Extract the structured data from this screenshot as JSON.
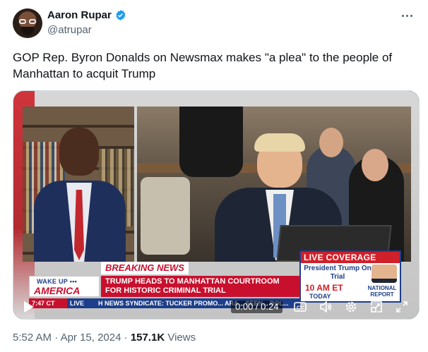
{
  "author": {
    "name": "Aaron Rupar",
    "handle": "@atrupar",
    "verified_color": "#1d9bf0"
  },
  "tweet": {
    "text": "GOP Rep. Byron Donalds on Newsmax makes \"a plea\" to the people of Manhattan to acquit Trump"
  },
  "video": {
    "breaking_label": "BREAKING NEWS",
    "headline": "TRUMP HEADS TO MANHATTAN COURTROOM FOR HISTORIC CRIMINAL TRIAL",
    "show_line1": "WAKE UP •••",
    "show_line2": "AMERICA",
    "ticker_time": "7:47 CT",
    "ticker_live": "LIVE",
    "ticker_text": "H NEWS SYNDICATE: TUCKER PROMO... ARA... SEEN... BOL...",
    "live_coverage": "LIVE COVERAGE",
    "live_sub": "President Trump On Trial",
    "live_time": "10 AM ET",
    "live_today": "TODAY",
    "national_report": "NATIONAL REPORT",
    "timer": "0:00 / 0:24",
    "brand_red": "#c8102e",
    "brand_blue": "#1d3e8a"
  },
  "meta": {
    "time": "5:52 AM",
    "separator": "·",
    "date": "Apr 15, 2024",
    "views_count": "157.1K",
    "views_label": "Views"
  },
  "icons": [
    "verified-badge-icon",
    "more-options-icon",
    "play-icon",
    "captions-icon",
    "volume-icon",
    "settings-icon",
    "picture-in-picture-icon",
    "fullscreen-icon"
  ]
}
